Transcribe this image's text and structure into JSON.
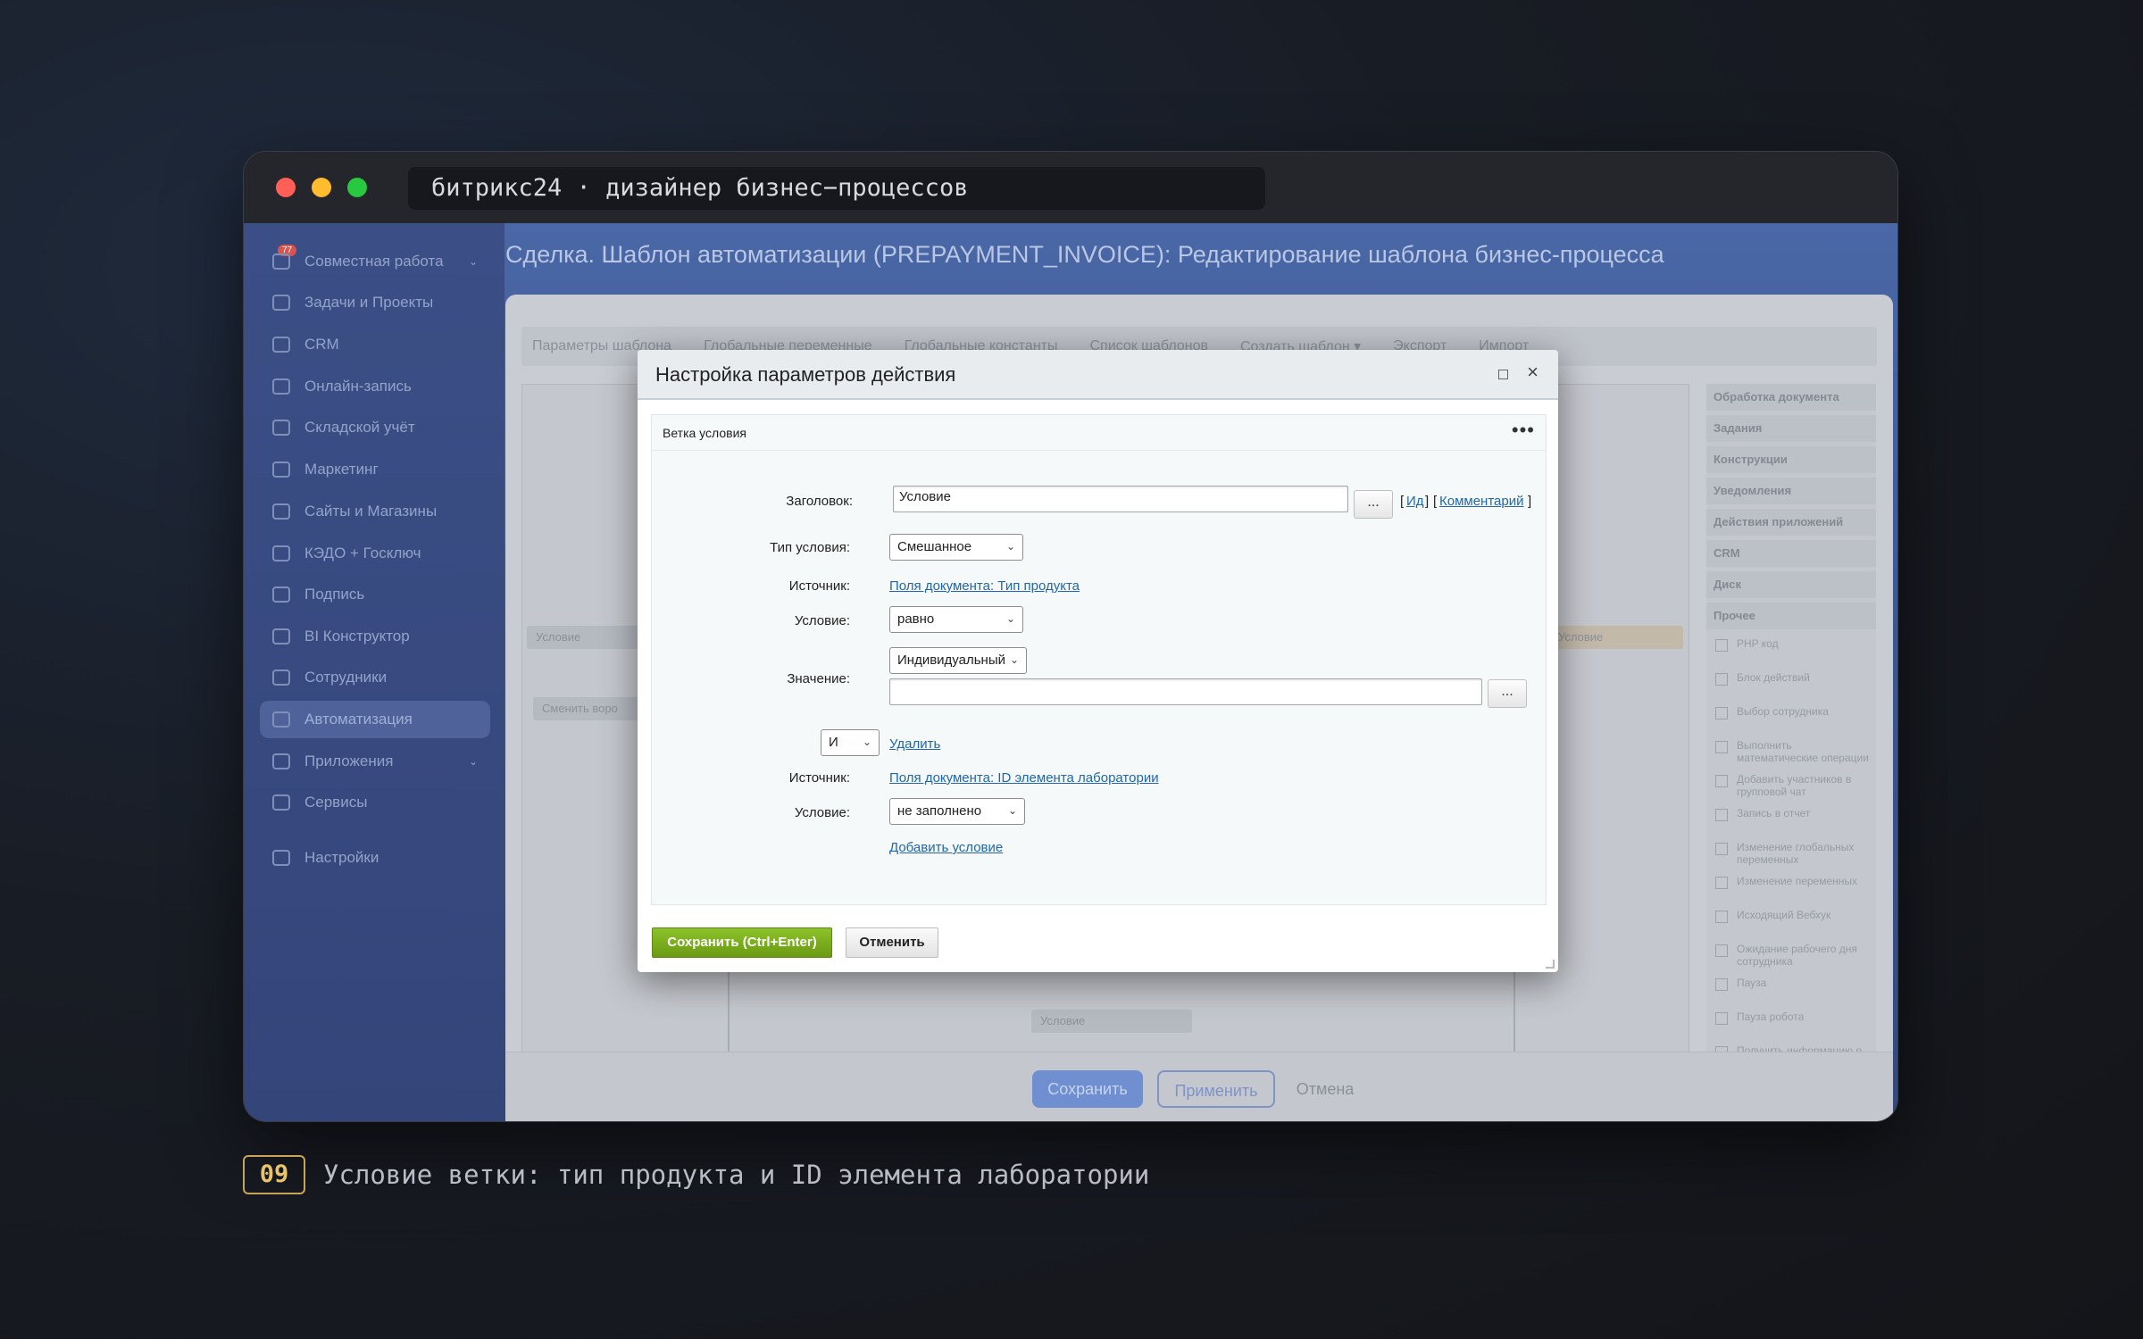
{
  "window": {
    "address": "битрикс24 · дизайнер бизнес−процессов"
  },
  "sidebar": {
    "badge": "77",
    "items": [
      {
        "label": "Совместная работа"
      },
      {
        "label": "Задачи и Проекты"
      },
      {
        "label": "CRM"
      },
      {
        "label": "Онлайн-запись"
      },
      {
        "label": "Складской учёт"
      },
      {
        "label": "Маркетинг"
      },
      {
        "label": "Сайты и Магазины"
      },
      {
        "label": "КЭДО + Госключ"
      },
      {
        "label": "Подпись"
      },
      {
        "label": "BI Конструктор"
      },
      {
        "label": "Сотрудники"
      },
      {
        "label": "Автоматизация"
      },
      {
        "label": "Приложения"
      },
      {
        "label": "Сервисы"
      },
      {
        "label": "Настройки"
      }
    ]
  },
  "page": {
    "title": "Сделка. Шаблон автоматизации (PREPAYMENT_INVOICE): Редактирование шаблона бизнес-процесса"
  },
  "tabs": [
    "Параметры шаблона",
    "Глобальные переменные",
    "Глобальные константы",
    "Список шаблонов",
    "Создать шаблон ▾",
    "Экспорт",
    "Импорт"
  ],
  "canvas": {
    "nodes": [
      "Условие",
      "Сменить воро",
      "Условие",
      "Условие"
    ]
  },
  "right_panel": {
    "groups": [
      "Обработка документа",
      "Задания",
      "Конструкции",
      "Уведомления",
      "Действия приложений",
      "CRM",
      "Диск",
      "Прочее"
    ],
    "items": [
      "PHP код",
      "Блок действий",
      "Выбор сотрудника",
      "Выполнить математические операции",
      "Добавить участников в групповой чат",
      "Запись в отчет",
      "Изменение глобальных переменных",
      "Изменение переменных",
      "Исходящий Вебхук",
      "Ожидание рабочего дня сотрудника",
      "Пауза",
      "Пауза робота",
      "Получить информацию о сотруднике"
    ]
  },
  "bottom_bar": {
    "save": "Сохранить",
    "apply": "Применить",
    "cancel": "Отмена"
  },
  "dialog": {
    "title": "Настройка параметров действия",
    "close": "×",
    "section_title": "Ветка условия",
    "more": "•••",
    "form": {
      "title_label": "Заголовок:",
      "title_value": "Условие",
      "dots": "...",
      "id_link": "Ид",
      "comment_link": "Комментарий",
      "bracket_open": "[",
      "bracket_close": "]",
      "type_label": "Тип условия:",
      "type_value": "Смешанное",
      "source_label": "Источник:",
      "source1_link": "Поля документа: Тип продукта",
      "condition_label": "Условие:",
      "condition1_value": "равно",
      "value_label": "Значение:",
      "value_mode": "Индивидуальный",
      "value_text": "",
      "logic_value": "И",
      "delete_link": "Удалить",
      "source2_link": "Поля документа: ID элемента лаборатории",
      "condition2_value": "не заполнено",
      "add_condition_link": "Добавить условие"
    },
    "buttons": {
      "save": "Сохранить (Ctrl+Enter)",
      "cancel": "Отменить"
    }
  },
  "caption": {
    "number": "09",
    "text": "Условие ветки: тип продукта и ID элемента лаборатории"
  }
}
